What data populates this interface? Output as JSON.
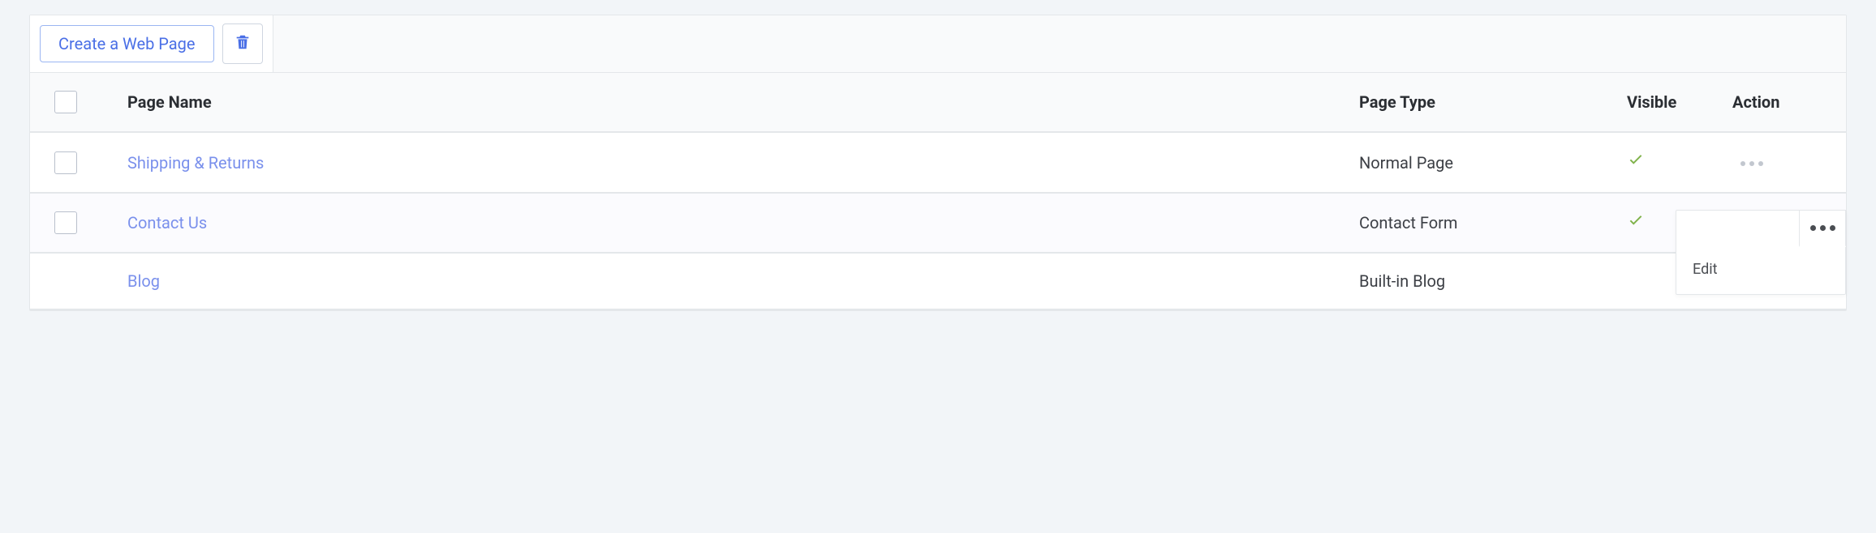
{
  "toolbar": {
    "create_label": "Create a Web Page"
  },
  "table": {
    "headers": {
      "name": "Page Name",
      "type": "Page Type",
      "visible": "Visible",
      "action": "Action"
    },
    "rows": [
      {
        "name": "Shipping & Returns",
        "type": "Normal Page",
        "visible": true,
        "has_checkbox": true,
        "alt": false
      },
      {
        "name": "Contact Us",
        "type": "Contact Form",
        "visible": true,
        "has_checkbox": true,
        "alt": true
      },
      {
        "name": "Blog",
        "type": "Built-in Blog",
        "visible": false,
        "has_checkbox": false,
        "alt": false
      }
    ]
  },
  "menu": {
    "edit_label": "Edit"
  }
}
